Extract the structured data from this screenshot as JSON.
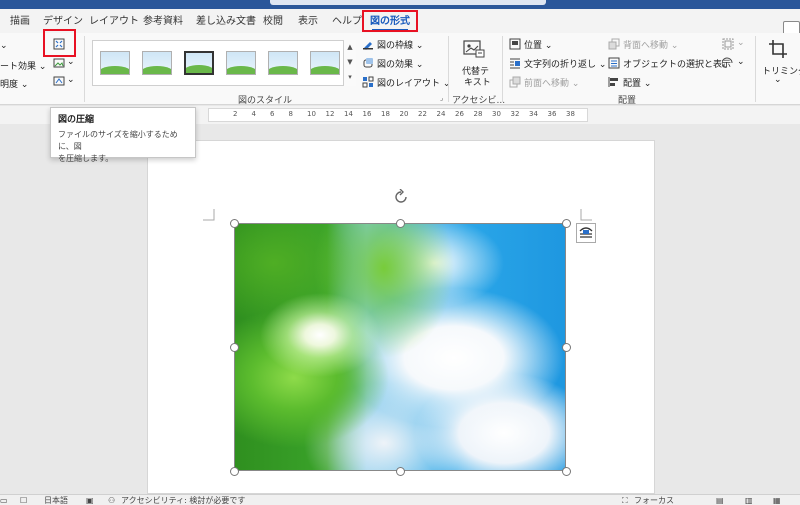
{
  "tabs": [
    {
      "label": "描画"
    },
    {
      "label": "デザイン"
    },
    {
      "label": "レイアウト"
    },
    {
      "label": "参考資料"
    },
    {
      "label": "差し込み文書"
    },
    {
      "label": "校閲"
    },
    {
      "label": "表示"
    },
    {
      "label": "ヘルプ"
    },
    {
      "label": "図の形式",
      "active": true
    }
  ],
  "ribbon": {
    "adjust": {
      "artistic_effects": "ート効果",
      "transparency": "明度"
    },
    "picture_styles": {
      "group_label": "図のスタイル",
      "border": "図の枠線",
      "effects": "図の効果",
      "layout": "図のレイアウト"
    },
    "accessibility": {
      "alt_text_line1": "代替テ",
      "alt_text_line2": "キスト",
      "group_label": "アクセシビ..."
    },
    "arrange": {
      "position": "位置",
      "wrap_text": "文字列の折り返し",
      "bring_forward": "前面へ移動",
      "send_backward": "背面へ移動",
      "selection_pane": "オブジェクトの選択と表示",
      "align": "配置",
      "group_label": "配置"
    },
    "size": {
      "crop": "トリミング"
    }
  },
  "tooltip": {
    "title": "図の圧縮",
    "body_line1": "ファイルのサイズを縮小するために、図",
    "body_line2": "を圧縮します。"
  },
  "ruler": {
    "numbers": [
      "2",
      "4",
      "6",
      "8",
      "10",
      "12",
      "14",
      "16",
      "18",
      "20",
      "22",
      "24",
      "26",
      "28",
      "30",
      "32",
      "34",
      "36",
      "38"
    ]
  },
  "statusbar": {
    "language": "日本語",
    "accessibility": "アクセシビリティ: 検討が必要です",
    "focus": "フォーカス"
  },
  "colors": {
    "title_bar": "#2b579a",
    "accent": "#185abd",
    "highlight_red": "#e81123"
  }
}
